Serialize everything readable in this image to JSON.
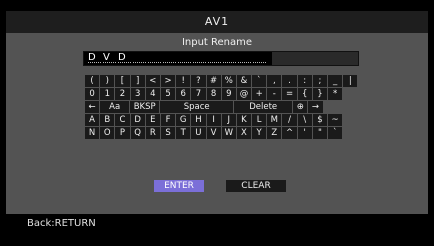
{
  "window": {
    "title": "AV1"
  },
  "panel": {
    "subtitle": "Input Rename"
  },
  "name_input": {
    "chars": [
      "D",
      "V",
      "D",
      "",
      "",
      "",
      "",
      "",
      "",
      "",
      "",
      ""
    ]
  },
  "keyboard": {
    "row1": [
      "(",
      ")",
      "[",
      "]",
      "<",
      ">",
      "!",
      "?",
      "#",
      "%",
      "&",
      "`",
      ",",
      ".",
      ":",
      ";",
      "_",
      "|"
    ],
    "row2": [
      "0",
      "1",
      "2",
      "3",
      "4",
      "5",
      "6",
      "7",
      "8",
      "9",
      "@",
      "+",
      "-",
      "=",
      "{",
      "}",
      "*"
    ],
    "row3_left_arrow": "←",
    "row3_case": "Aa",
    "row3_bksp": "BKSP",
    "row3_space": "Space",
    "row3_delete": "Delete",
    "row3_globe": "⊕",
    "row3_right_arrow": "→",
    "row4": [
      "A",
      "B",
      "C",
      "D",
      "E",
      "F",
      "G",
      "H",
      "I",
      "J",
      "K",
      "L",
      "M",
      "/",
      "\\",
      "$",
      "~"
    ],
    "row5": [
      "N",
      "O",
      "P",
      "Q",
      "R",
      "S",
      "T",
      "U",
      "V",
      "W",
      "X",
      "Y",
      "Z",
      "^",
      "'",
      "\"",
      "`"
    ]
  },
  "buttons": {
    "enter_label": "ENTER",
    "clear_label": "CLEAR"
  },
  "footer": {
    "hint": "Back:RETURN"
  }
}
